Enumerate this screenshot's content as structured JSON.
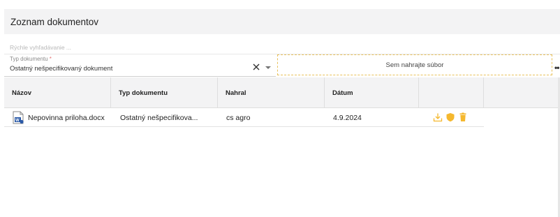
{
  "panel": {
    "title": "Zoznam dokumentov"
  },
  "search": {
    "placeholder": "Rýchle vyhľadávanie ..."
  },
  "filter": {
    "type_label": "Typ dokumentu",
    "required_mark": "*",
    "type_value": "Ostatný nešpecifikovaný dokument",
    "upload_text": "Sem nahrajte súbor",
    "more_glyph": "••"
  },
  "table": {
    "columns": [
      "Názov",
      "Typ dokumentu",
      "Nahral",
      "Dátum",
      "",
      ""
    ],
    "rows": [
      {
        "name": "Nepovinna priloha.docx",
        "type": "Ostatný nešpecifikova...",
        "uploaded_by": "cs agro",
        "date": "4.9.2024",
        "file_icon": "word-document-icon",
        "actions": [
          "download-icon",
          "shield-icon",
          "trash-icon"
        ]
      }
    ]
  },
  "colors": {
    "header_bg": "#f3f3f4",
    "accent": "#f5b82e",
    "word_blue": "#2b5aa8"
  }
}
